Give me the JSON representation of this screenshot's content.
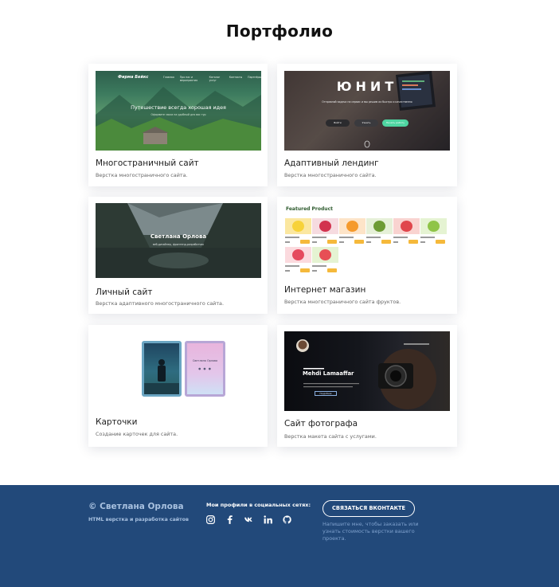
{
  "page": {
    "title": "Портфолио"
  },
  "projects": [
    {
      "title": "Многостраничный сайт",
      "description": "Верстка многостраничного сайта.",
      "preview": {
        "logo": "Фирма Бейкс",
        "nav": [
          "Главная",
          "Про нас и мероприятия",
          "Каталог услуг",
          "Контакты",
          "Партнёры"
        ],
        "headline": "Путешествие всегда хорошая идея",
        "subline": "Оформите заказ на удобный для вас тур"
      }
    },
    {
      "title": "Адаптивный лендинг",
      "description": "Верстка многостраничного сайта.",
      "preview": {
        "headline": "ЮНИТ",
        "subline": "Отправляй задачи на сервис и мы решим их быстро и качественно",
        "buttons": [
          "Войти",
          "Узнать",
          "Начать работу"
        ]
      }
    },
    {
      "title": "Личный сайт",
      "description": "Верстка адаптивного многостраничного сайта.",
      "preview": {
        "headline": "Светлана Орлова",
        "subline": "веб-дизайнер, фронтенд-разработчик"
      }
    },
    {
      "title": "Интернет магазин",
      "description": "Верстка многостраничного сайта фруктов.",
      "preview": {
        "heading": "Featured Product",
        "fruits": [
          {
            "name": "banana",
            "color": "#f7d23a",
            "bg": "#fbe7a0"
          },
          {
            "name": "berries",
            "color": "#d2334e",
            "bg": "#f6dbe0"
          },
          {
            "name": "orange",
            "color": "#f59a2c",
            "bg": "#fde4c8"
          },
          {
            "name": "avocado",
            "color": "#6e9b35",
            "bg": "#e6f0d8"
          },
          {
            "name": "apple",
            "color": "#e0464c",
            "bg": "#f9d3d0"
          },
          {
            "name": "green-apple",
            "color": "#8fc447",
            "bg": "#e5f3d2"
          },
          {
            "name": "strawberry",
            "color": "#e54a5e",
            "bg": "#fbdade"
          },
          {
            "name": "watermelon",
            "color": "#e74f55",
            "bg": "#e5f3d2"
          }
        ]
      }
    },
    {
      "title": "Карточки",
      "description": "Создание карточек для сайта.",
      "preview": {
        "card_name": "Светлана Орлова"
      }
    },
    {
      "title": "Сайт фотографа",
      "description": "Верстка макета сайта с услугами.",
      "preview": {
        "headline": "Mehdi Lamaaffar",
        "button": "Подробнее"
      }
    }
  ],
  "footer": {
    "name": "© Светлана Орлова",
    "subtitle": "HTML верстка и разработка сайтов",
    "social_title": "Мои профили в социальных сетях:",
    "social_icons": [
      "instagram-icon",
      "facebook-icon",
      "vk-icon",
      "linkedin-icon",
      "github-icon"
    ],
    "contact_button": "СВЯЗАТЬСЯ ВКОНТАКТЕ",
    "note": "Напишите мне, чтобы заказать или узнать стоимость верстки вашего проекта."
  },
  "colors": {
    "footer_bg": "#22497a",
    "footer_text": "#a8c1e0",
    "card_shadow": "rgba(30,40,70,0.13)"
  }
}
